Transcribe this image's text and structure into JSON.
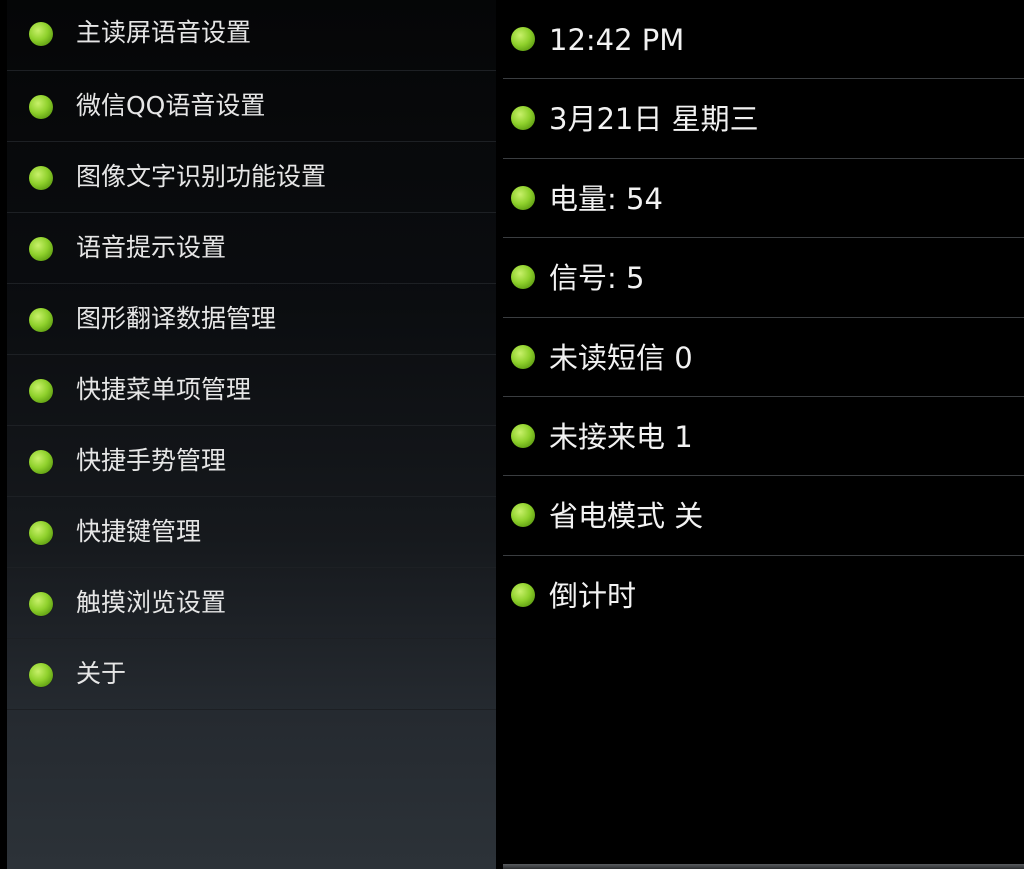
{
  "left_menu": {
    "items": [
      {
        "label": "主读屏语音设置"
      },
      {
        "label": "微信QQ语音设置"
      },
      {
        "label": "图像文字识别功能设置"
      },
      {
        "label": "语音提示设置"
      },
      {
        "label": "图形翻译数据管理"
      },
      {
        "label": "快捷菜单项管理"
      },
      {
        "label": "快捷手势管理"
      },
      {
        "label": "快捷键管理"
      },
      {
        "label": "触摸浏览设置"
      },
      {
        "label": "关于"
      }
    ]
  },
  "status_list": {
    "items": [
      {
        "label": "12:42 PM"
      },
      {
        "label": "3月21日 星期三"
      },
      {
        "label": "电量: 54"
      },
      {
        "label": "信号: 5"
      },
      {
        "label": "未读短信 0"
      },
      {
        "label": "未接来电 1"
      },
      {
        "label": "省电模式 关"
      },
      {
        "label": "倒计时"
      }
    ]
  },
  "colors": {
    "bullet": "#8fd12c",
    "background": "#000000",
    "text": "#e6e6e6"
  },
  "icons": {
    "bullet": "green-dot-icon"
  }
}
